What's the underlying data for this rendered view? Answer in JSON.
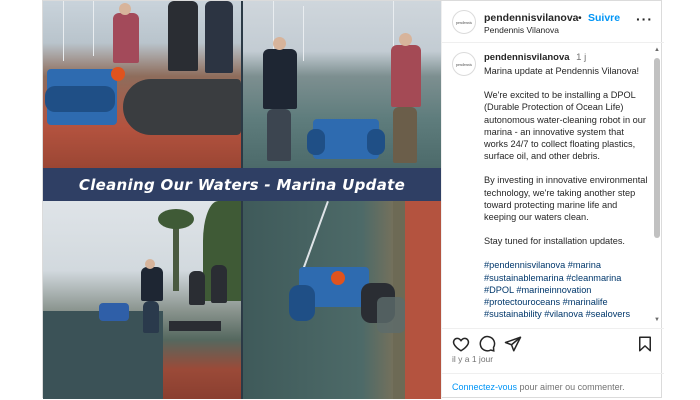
{
  "post": {
    "username": "pendennisvilanova",
    "follow_separator": "•",
    "follow_label": "Suivre",
    "location": "Pendennis Vilanova",
    "avatar_text": "pendennis",
    "more_icon": "ellipsis-icon",
    "media": {
      "banner_text": "Cleaning Our Waters - Marina Update"
    },
    "caption": {
      "username": "pendennisvilanova",
      "time": "1 j",
      "paragraphs": [
        "Marina update at Pendennis Vilanova!",
        "We're excited to be installing a DPOL (Durable Protection of Ocean Life) autonomous water-cleaning robot in our marina - an innovative system that works 24/7 to collect floating plastics, surface oil, and other debris.",
        "By investing in innovative environmental technology, we're taking another step toward protecting marine life and keeping our waters clean.",
        "Stay tuned for installation updates."
      ],
      "hashtags": "#pendennisvilanova #marina #sustainablemarina #cleanmarina #DPOL #marineinnovation #protectouroceans #marinalife #sustainability #vilanova #sealovers"
    },
    "actions": {
      "like_icon": "heart-icon",
      "comment_icon": "comment-icon",
      "share_icon": "share-icon",
      "save_icon": "bookmark-icon"
    },
    "posted_time": "il y a 1 jour",
    "comment_prompt": {
      "link": "Connectez-vous",
      "text": " pour aimer ou commenter."
    },
    "colors": {
      "accent": "#0095f6",
      "banner": "#2f3f64",
      "hashtag": "#00376b"
    }
  }
}
